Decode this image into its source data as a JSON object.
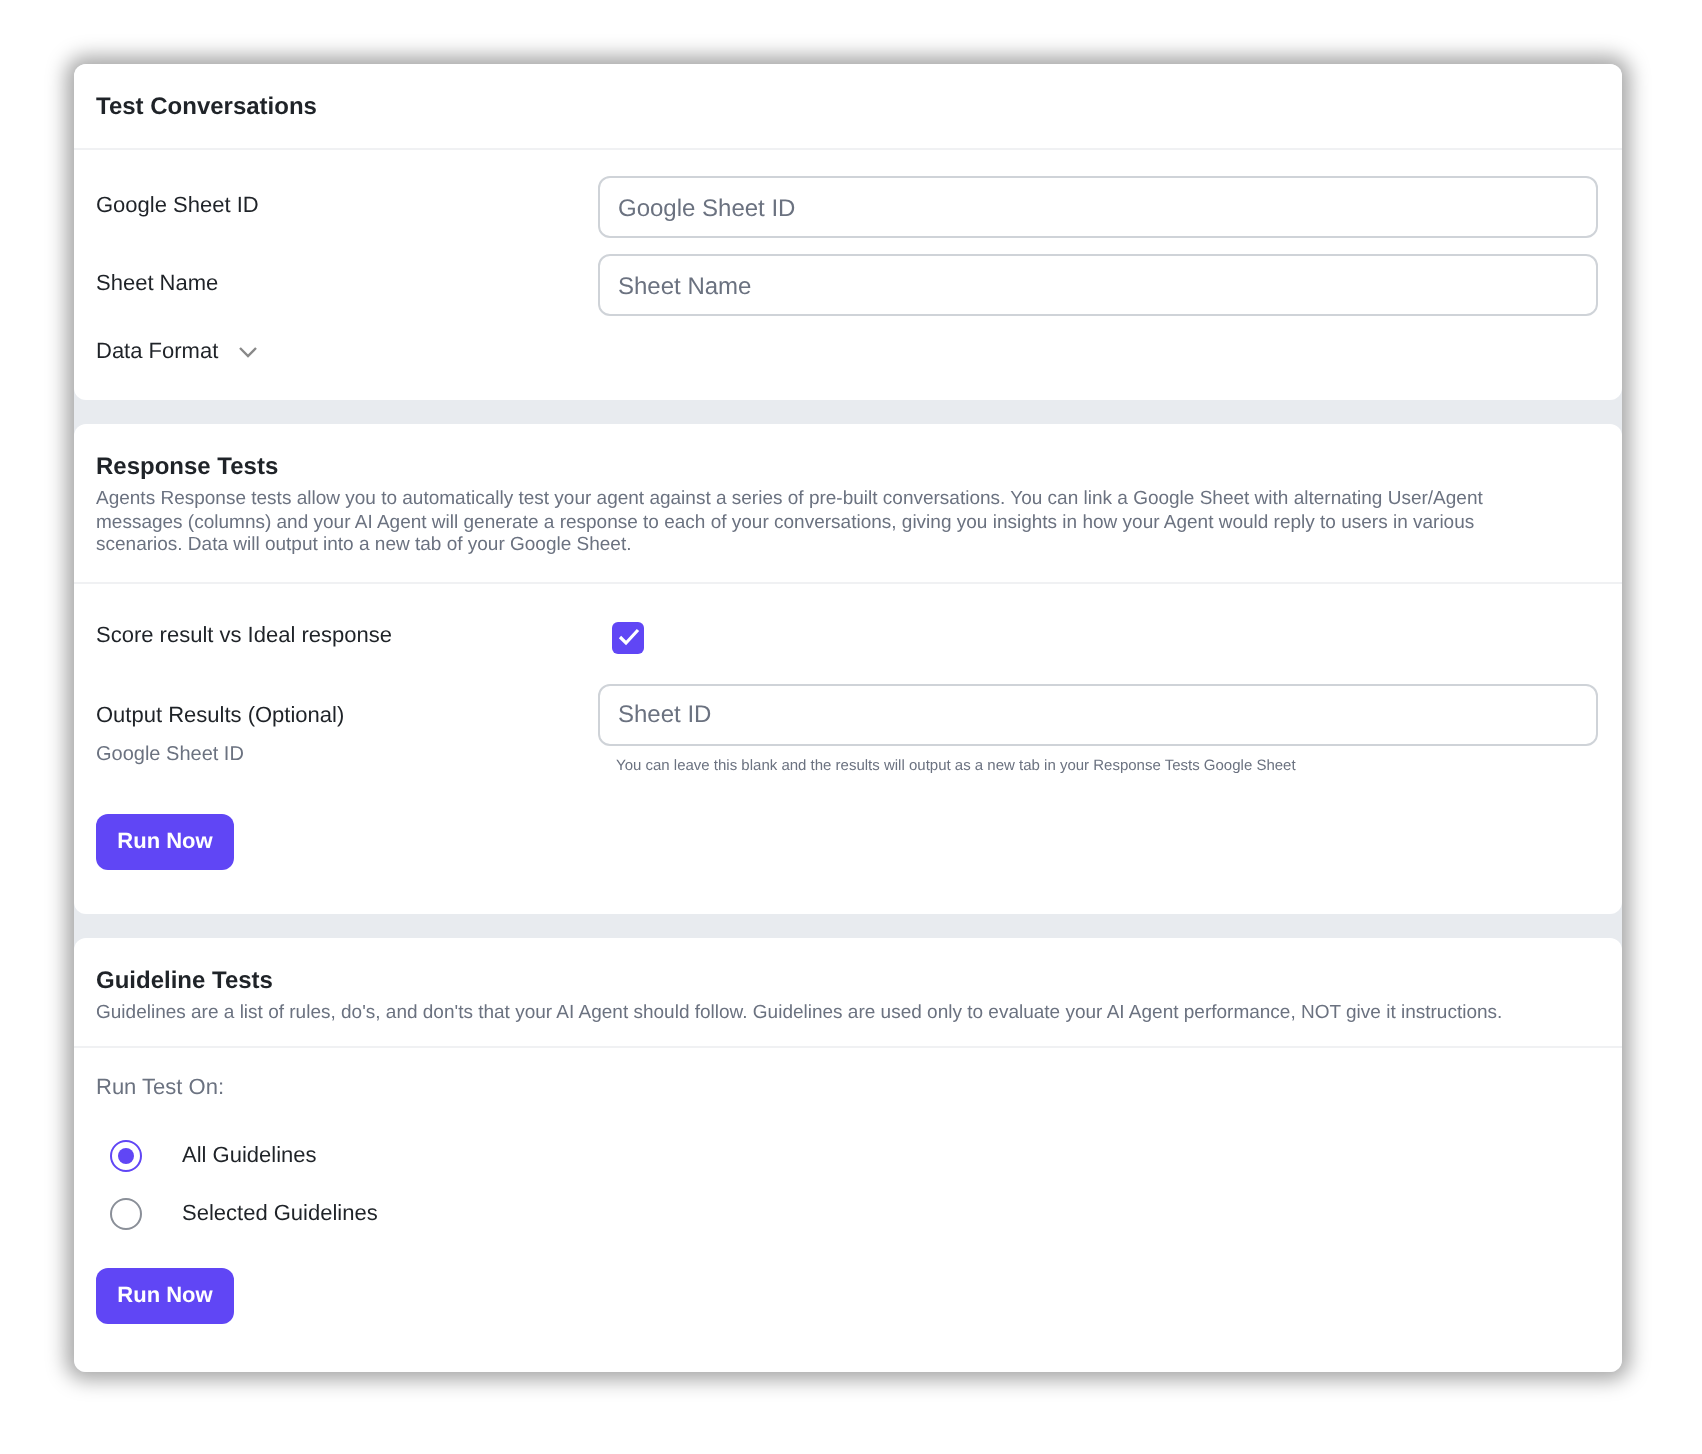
{
  "test_conversations": {
    "title": "Test Conversations",
    "fields": [
      {
        "label": "Google Sheet ID",
        "placeholder": "Google Sheet ID"
      },
      {
        "label": "Sheet Name",
        "placeholder": "Sheet Name"
      }
    ],
    "data_format": {
      "label": "Data Format",
      "expanded": false
    }
  },
  "response_tests": {
    "title": "Response Tests",
    "description": "Agents Response tests allow you to automatically test your agent against a series of pre-built conversations. You can link a Google Sheet with alternating User/Agent messages (columns) and your AI Agent will generate a response to each of your conversations, giving you insights in how your Agent would reply to users in various scenarios. Data will output into a new tab of your Google Sheet.",
    "score": {
      "label": "Score result vs Ideal response",
      "checked": true
    },
    "output": {
      "label": "Output Results (Optional)",
      "sublabel": "Google Sheet ID",
      "placeholder": "Sheet ID",
      "hint": "You can leave this blank and the results will output as a new tab in your Response Tests Google Sheet"
    },
    "button": "Run Now"
  },
  "guideline_tests": {
    "title": "Guideline Tests",
    "description": "Guidelines are a list of rules, do's, and don'ts that your AI Agent should follow. Guidelines are used only to evaluate your AI Agent performance, NOT give it instructions.",
    "run_on_label": "Run Test On:",
    "options": [
      {
        "label": "All Guidelines",
        "selected": true
      },
      {
        "label": "Selected Guidelines",
        "selected": false
      }
    ],
    "button": "Run Now"
  }
}
